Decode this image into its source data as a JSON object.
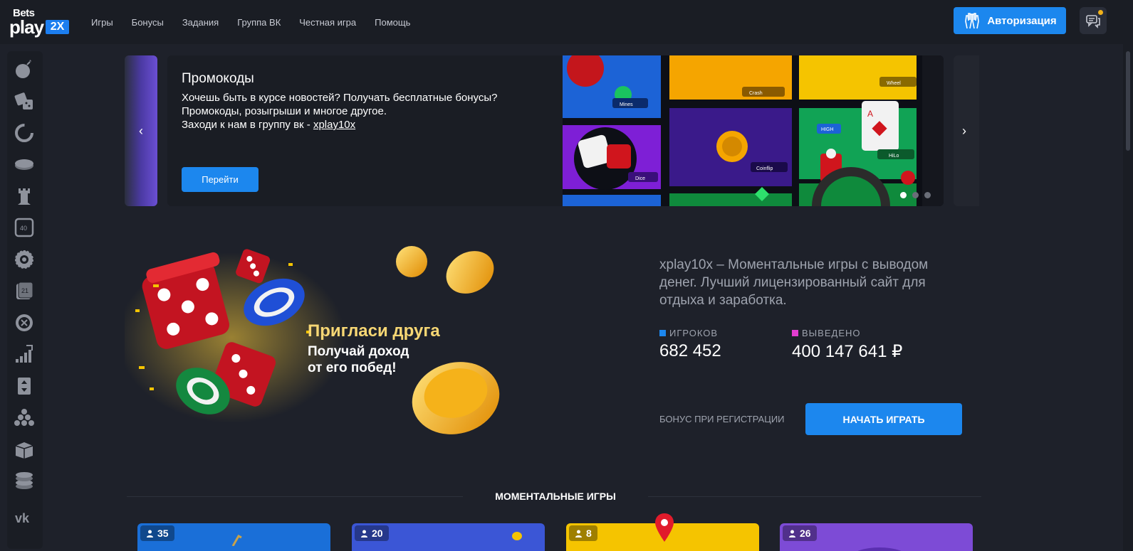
{
  "header": {
    "logo": {
      "bets": "Bets",
      "play": "play",
      "tag": "2X"
    },
    "nav": [
      "Игры",
      "Бонусы",
      "Задания",
      "Группа ВК",
      "Честная игра",
      "Помощь"
    ],
    "auth_label": "Авторизация"
  },
  "sidebar": {
    "icons": [
      "bomb-icon",
      "dice-icon",
      "circle-progress-icon",
      "coin-icon",
      "tower-icon",
      "keno-icon",
      "wheel-icon",
      "cards-21-icon",
      "roulette-icon",
      "chart-up-icon",
      "hilo-card-icon",
      "plinko-icon",
      "box-icon",
      "coins-stack-icon",
      "vk-icon"
    ]
  },
  "carousel": {
    "title": "Промокоды",
    "text_line1": "Хочешь быть в курсе новостей? Получать бесплатные бонусы?",
    "text_line2": "Промокоды, розыгрыши и многое другое.",
    "text_line3_prefix": "Заходи к нам в группу вк - ",
    "text_link": "xplay10x",
    "button": "Перейти",
    "art_labels": [
      "Mines",
      "Crash",
      "Wheel",
      "Dice",
      "Coinflip",
      "HiLo",
      "HIGH"
    ],
    "active_dot": 1,
    "dots": 3
  },
  "promo": {
    "title": "Пригласи друга",
    "sub_line1": "Получай доход",
    "sub_line2": "от его побед!"
  },
  "about": {
    "text": "xplay10x – Моментальные игры с выводом денег. Лучший лицензированный сайт для отдыха и заработка.",
    "players_label": "ИГРОКОВ",
    "players_value": "682 452",
    "withdrawn_label": "ВЫВЕДЕНО",
    "withdrawn_value": "400 147 641 ₽",
    "bonus_label": "БОНУС ПРИ РЕГИСТРАЦИИ",
    "play_button": "НАЧАТЬ ИГРАТЬ"
  },
  "section": {
    "title": "МОМЕНТАЛЬНЫЕ ИГРЫ"
  },
  "games": [
    {
      "count": "35",
      "color": "#1a6fd8"
    },
    {
      "count": "20",
      "color": "#3b56d6"
    },
    {
      "count": "8",
      "color": "#f5c400"
    },
    {
      "count": "26",
      "color": "#7d4bd6"
    }
  ],
  "colors": {
    "accent": "#1c87ee",
    "players_marker": "#1c87ee",
    "withdrawn_marker": "#e23dd0",
    "invite_title": "#f7d774"
  }
}
